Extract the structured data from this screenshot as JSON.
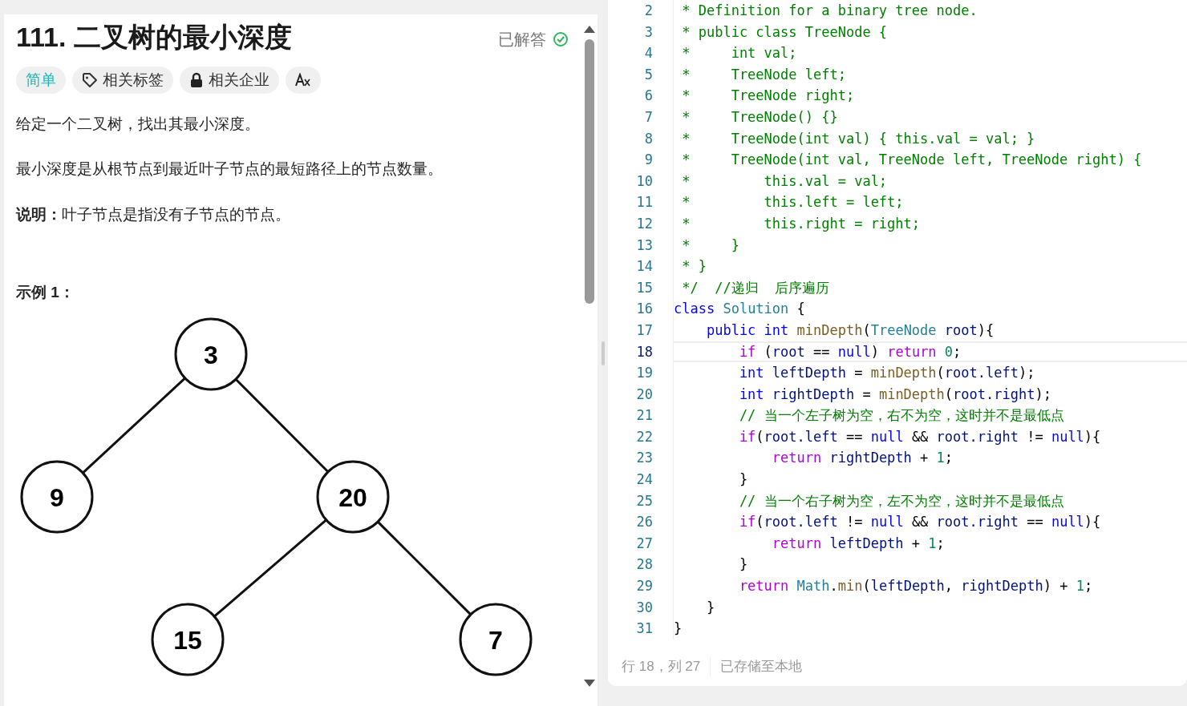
{
  "problem": {
    "title": "111. 二叉树的最小深度",
    "status": "已解答",
    "tags": [
      {
        "kind": "difficulty",
        "label": "简单"
      },
      {
        "kind": "tag",
        "label": "相关标签"
      },
      {
        "kind": "locked",
        "label": "相关企业"
      },
      {
        "kind": "translate"
      }
    ],
    "paragraphs": [
      {
        "kind": "text",
        "text": "给定一个二叉树，找出其最小深度。"
      },
      {
        "kind": "text",
        "text": "最小深度是从根节点到最近叶子节点的最短路径上的节点数量。"
      },
      {
        "kind": "text",
        "text": "**说明：**叶子节点是指没有子节点的节点。"
      },
      {
        "kind": "heading",
        "text": "示例 1："
      }
    ],
    "tree": {
      "label": "3",
      "children": [
        {
          "label": "9"
        },
        {
          "label": "20",
          "children": [
            {
              "label": "15"
            },
            {
              "label": "7"
            }
          ]
        }
      ]
    }
  },
  "editor": {
    "lines": [
      {
        "n": "2",
        "current": false,
        "segs": [
          {
            "kind": "comment",
            "text": " * Definition for a binary tree node."
          }
        ]
      },
      {
        "n": "3",
        "current": false,
        "segs": [
          {
            "kind": "comment",
            "text": " * public class TreeNode {"
          }
        ]
      },
      {
        "n": "4",
        "current": false,
        "segs": [
          {
            "kind": "comment",
            "text": " *     int val;"
          }
        ]
      },
      {
        "n": "5",
        "current": false,
        "segs": [
          {
            "kind": "comment",
            "text": " *     TreeNode left;"
          }
        ]
      },
      {
        "n": "6",
        "current": false,
        "segs": [
          {
            "kind": "comment",
            "text": " *     TreeNode right;"
          }
        ]
      },
      {
        "n": "7",
        "current": false,
        "segs": [
          {
            "kind": "comment",
            "text": " *     TreeNode() {}"
          }
        ]
      },
      {
        "n": "8",
        "current": false,
        "segs": [
          {
            "kind": "comment",
            "text": " *     TreeNode(int val) { this.val = val; }"
          }
        ]
      },
      {
        "n": "9",
        "current": false,
        "segs": [
          {
            "kind": "comment",
            "text": " *     TreeNode(int val, TreeNode left, TreeNode right) {"
          }
        ]
      },
      {
        "n": "10",
        "current": false,
        "segs": [
          {
            "kind": "comment",
            "text": " *         this.val = val;"
          }
        ]
      },
      {
        "n": "11",
        "current": false,
        "segs": [
          {
            "kind": "comment",
            "text": " *         this.left = left;"
          }
        ]
      },
      {
        "n": "12",
        "current": false,
        "segs": [
          {
            "kind": "comment",
            "text": " *         this.right = right;"
          }
        ]
      },
      {
        "n": "13",
        "current": false,
        "segs": [
          {
            "kind": "comment",
            "text": " *     }"
          }
        ]
      },
      {
        "n": "14",
        "current": false,
        "segs": [
          {
            "kind": "comment",
            "text": " * }"
          }
        ]
      },
      {
        "n": "15",
        "current": false,
        "segs": [
          {
            "kind": "comment",
            "text": " */  //递归  后序遍历"
          }
        ]
      },
      {
        "n": "16",
        "current": false,
        "segs": [
          {
            "kind": "keyword",
            "text": "class "
          },
          {
            "kind": "type",
            "text": "Solution "
          },
          {
            "kind": "plain",
            "text": "{"
          }
        ]
      },
      {
        "n": "17",
        "current": false,
        "segs": [
          {
            "kind": "keyword",
            "text": "    public "
          },
          {
            "kind": "keyword",
            "text": "int "
          },
          {
            "kind": "function",
            "text": "minDepth"
          },
          {
            "kind": "plain",
            "text": "("
          },
          {
            "kind": "type",
            "text": "TreeNode "
          },
          {
            "kind": "variable",
            "text": "root"
          },
          {
            "kind": "plain",
            "text": "){"
          }
        ]
      },
      {
        "n": "18",
        "current": true,
        "segs": [
          {
            "kind": "control",
            "text": "        if"
          },
          {
            "kind": "plain",
            "text": " ("
          },
          {
            "kind": "variable",
            "text": "root"
          },
          {
            "kind": "plain",
            "text": " == "
          },
          {
            "kind": "keyword",
            "text": "null"
          },
          {
            "kind": "plain",
            "text": ") "
          },
          {
            "kind": "control",
            "text": "return "
          },
          {
            "kind": "number",
            "text": "0"
          },
          {
            "kind": "plain",
            "text": ";"
          }
        ]
      },
      {
        "n": "19",
        "current": false,
        "segs": [
          {
            "kind": "keyword",
            "text": "        int "
          },
          {
            "kind": "variable",
            "text": "leftDepth"
          },
          {
            "kind": "plain",
            "text": " = "
          },
          {
            "kind": "function",
            "text": "minDepth"
          },
          {
            "kind": "plain",
            "text": "("
          },
          {
            "kind": "variable",
            "text": "root.left"
          },
          {
            "kind": "plain",
            "text": ");"
          }
        ]
      },
      {
        "n": "20",
        "current": false,
        "segs": [
          {
            "kind": "keyword",
            "text": "        int "
          },
          {
            "kind": "variable",
            "text": "rightDepth"
          },
          {
            "kind": "plain",
            "text": " = "
          },
          {
            "kind": "function",
            "text": "minDepth"
          },
          {
            "kind": "plain",
            "text": "("
          },
          {
            "kind": "variable",
            "text": "root.right"
          },
          {
            "kind": "plain",
            "text": ");"
          }
        ]
      },
      {
        "n": "21",
        "current": false,
        "segs": [
          {
            "kind": "comment",
            "text": "        // 当一个左子树为空，右不为空，这时并不是最低点"
          }
        ]
      },
      {
        "n": "22",
        "current": false,
        "segs": [
          {
            "kind": "control",
            "text": "        if"
          },
          {
            "kind": "plain",
            "text": "("
          },
          {
            "kind": "variable",
            "text": "root.left"
          },
          {
            "kind": "plain",
            "text": " == "
          },
          {
            "kind": "keyword",
            "text": "null"
          },
          {
            "kind": "plain",
            "text": " && "
          },
          {
            "kind": "variable",
            "text": "root.right"
          },
          {
            "kind": "plain",
            "text": " != "
          },
          {
            "kind": "keyword",
            "text": "null"
          },
          {
            "kind": "plain",
            "text": "){"
          }
        ]
      },
      {
        "n": "23",
        "current": false,
        "segs": [
          {
            "kind": "control",
            "text": "            return "
          },
          {
            "kind": "variable",
            "text": "rightDepth"
          },
          {
            "kind": "plain",
            "text": " + "
          },
          {
            "kind": "number",
            "text": "1"
          },
          {
            "kind": "plain",
            "text": ";"
          }
        ]
      },
      {
        "n": "24",
        "current": false,
        "segs": [
          {
            "kind": "plain",
            "text": "        }"
          }
        ]
      },
      {
        "n": "25",
        "current": false,
        "segs": [
          {
            "kind": "comment",
            "text": "        // 当一个右子树为空，左不为空，这时并不是最低点"
          }
        ]
      },
      {
        "n": "26",
        "current": false,
        "segs": [
          {
            "kind": "control",
            "text": "        if"
          },
          {
            "kind": "plain",
            "text": "("
          },
          {
            "kind": "variable",
            "text": "root.left"
          },
          {
            "kind": "plain",
            "text": " != "
          },
          {
            "kind": "keyword",
            "text": "null"
          },
          {
            "kind": "plain",
            "text": " && "
          },
          {
            "kind": "variable",
            "text": "root.right"
          },
          {
            "kind": "plain",
            "text": " == "
          },
          {
            "kind": "keyword",
            "text": "null"
          },
          {
            "kind": "plain",
            "text": "){"
          }
        ]
      },
      {
        "n": "27",
        "current": false,
        "segs": [
          {
            "kind": "control",
            "text": "            return "
          },
          {
            "kind": "variable",
            "text": "leftDepth"
          },
          {
            "kind": "plain",
            "text": " + "
          },
          {
            "kind": "number",
            "text": "1"
          },
          {
            "kind": "plain",
            "text": ";"
          }
        ]
      },
      {
        "n": "28",
        "current": false,
        "segs": [
          {
            "kind": "plain",
            "text": "        }"
          }
        ]
      },
      {
        "n": "29",
        "current": false,
        "segs": [
          {
            "kind": "control",
            "text": "        return "
          },
          {
            "kind": "type",
            "text": "Math"
          },
          {
            "kind": "plain",
            "text": "."
          },
          {
            "kind": "function",
            "text": "min"
          },
          {
            "kind": "plain",
            "text": "("
          },
          {
            "kind": "variable",
            "text": "leftDepth"
          },
          {
            "kind": "plain",
            "text": ", "
          },
          {
            "kind": "variable",
            "text": "rightDepth"
          },
          {
            "kind": "plain",
            "text": ") + "
          },
          {
            "kind": "number",
            "text": "1"
          },
          {
            "kind": "plain",
            "text": ";"
          }
        ]
      },
      {
        "n": "30",
        "current": false,
        "segs": [
          {
            "kind": "plain",
            "text": "    }"
          }
        ]
      },
      {
        "n": "31",
        "current": false,
        "segs": [
          {
            "kind": "plain",
            "text": "}"
          }
        ]
      }
    ],
    "status_bar": {
      "position": "行 18，列 27",
      "saved": "已存储至本地"
    }
  }
}
